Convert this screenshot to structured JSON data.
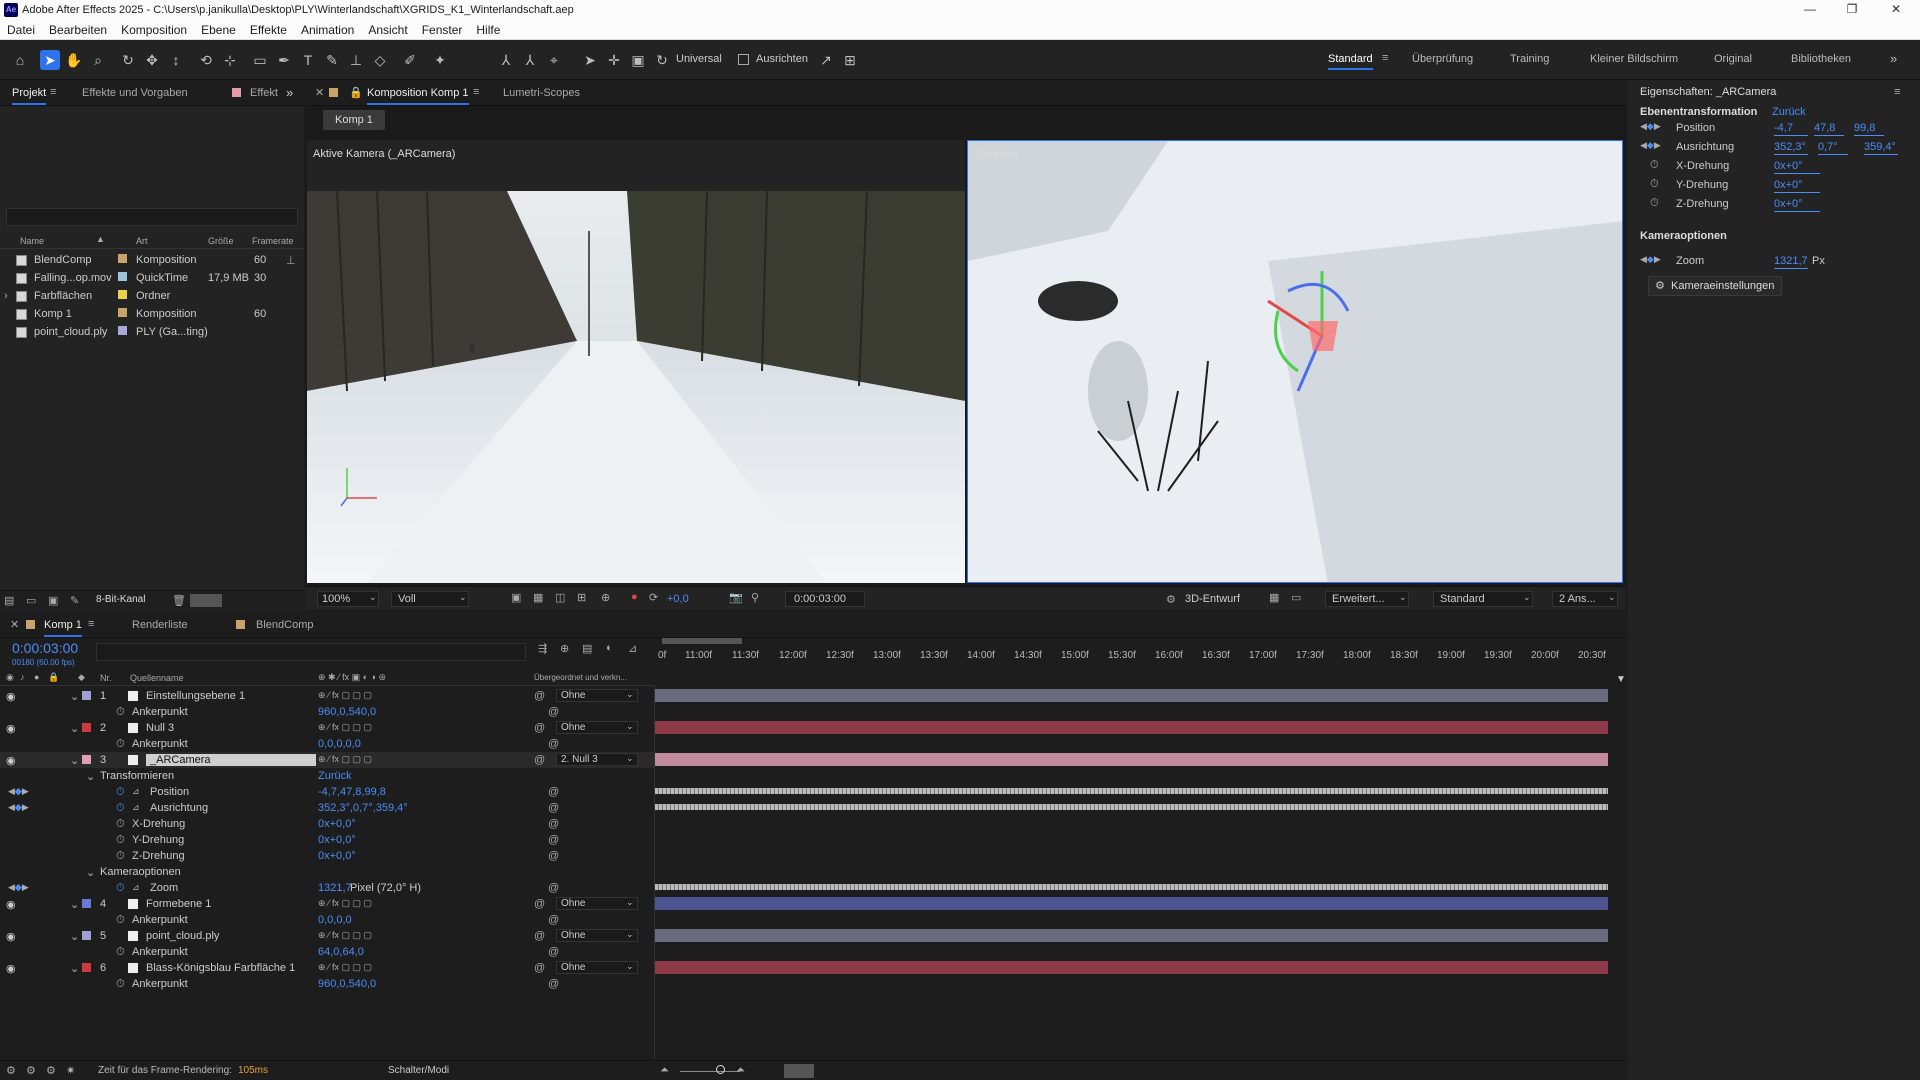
{
  "app": {
    "title": "Adobe After Effects 2025 - C:\\Users\\p.janikulla\\Desktop\\PLY\\Winterlandschaft\\XGRIDS_K1_Winterlandschaft.aep",
    "logo": "Ae"
  },
  "menu": [
    "Datei",
    "Bearbeiten",
    "Komposition",
    "Ebene",
    "Effekte",
    "Animation",
    "Ansicht",
    "Fenster",
    "Hilfe"
  ],
  "toolbar": {
    "universal": "Universal",
    "ausrichten": "Ausrichten"
  },
  "workspaces": [
    "Standard",
    "Überprüfung",
    "Training",
    "Kleiner Bildschirm",
    "Original",
    "Bibliotheken"
  ],
  "project": {
    "tabs": [
      "Projekt",
      "Effekte und Vorgaben",
      "Effekt"
    ],
    "columns": {
      "name": "Name",
      "type": "Art",
      "size": "Größe",
      "fps": "Framerate"
    },
    "items": [
      {
        "name": "BlendComp",
        "type": "Komposition",
        "size": "",
        "fps": "60",
        "color": "#c9a36a"
      },
      {
        "name": "Falling...op.mov",
        "type": "QuickTime",
        "size": "17,9 MB",
        "fps": "30",
        "color": "#9bc4e0"
      },
      {
        "name": "Farbflächen",
        "type": "Ordner",
        "size": "",
        "fps": "",
        "color": "#e8d24a"
      },
      {
        "name": "Komp 1",
        "type": "Komposition",
        "size": "",
        "fps": "60",
        "color": "#c9a36a"
      },
      {
        "name": "point_cloud.ply",
        "type": "PLY (Ga...ting)",
        "size": "",
        "fps": "",
        "color": "#a9a9d6"
      }
    ],
    "bitdepth": "8-Bit-Kanal"
  },
  "comp": {
    "tabs": [
      "Komposition Komp 1",
      "Lumetri-Scopes"
    ],
    "crumb": "Komp 1",
    "left_view_label": "Aktive Kamera (_ARCamera)",
    "right_view_label": "Standard",
    "bottom": {
      "zoom": "100%",
      "res": "Voll",
      "exposure": "+0,0",
      "time": "0:00:03:00",
      "renderer": "3D-Entwurf",
      "ext": "Erweitert...",
      "view": "Standard",
      "layout": "2 Ans..."
    }
  },
  "props": {
    "title": "Eigenschaften: _ARCamera",
    "section1": "Ebenentransformation",
    "reset": "Zurück",
    "rows": [
      {
        "label": "Position",
        "v1": "-4,7",
        "v2": "47,8",
        "v3": "99,8"
      },
      {
        "label": "Ausrichtung",
        "v1": "352,3°",
        "v2": "0,7°",
        "v3": "359,4°"
      },
      {
        "label": "X-Drehung",
        "v1": "0x+0°"
      },
      {
        "label": "Y-Drehung",
        "v1": "0x+0°"
      },
      {
        "label": "Z-Drehung",
        "v1": "0x+0°"
      }
    ],
    "section2": "Kameraoptionen",
    "zoom_label": "Zoom",
    "zoom_val": "1321,7",
    "zoom_unit": "Px",
    "settings_btn": "Kameraeinstellungen"
  },
  "timeline": {
    "tabs": [
      "Komp 1",
      "Renderliste",
      "BlendComp"
    ],
    "timecode": "0:00:03:00",
    "frames": "00180 (60.00 fps)",
    "hdr": {
      "nr": "Nr.",
      "src": "Quellenname",
      "parent": "Übergeordnet und verkn..."
    },
    "ruler": [
      "0f",
      "11:00f",
      "11:30f",
      "12:00f",
      "12:30f",
      "13:00f",
      "13:30f",
      "14:00f",
      "14:30f",
      "15:00f",
      "15:30f",
      "16:00f",
      "16:30f",
      "17:00f",
      "17:30f",
      "18:00f",
      "18:30f",
      "19:00f",
      "19:30f",
      "20:00f",
      "20:30f"
    ],
    "rows": [
      {
        "nr": "1",
        "name": "Einstellungsebene 1",
        "parent": "Ohne",
        "color": "#a0a0d6",
        "bar": "#6b6b80"
      },
      {
        "sub": "Ankerpunkt",
        "val": "960,0,540,0"
      },
      {
        "nr": "2",
        "name": "Null 3",
        "parent": "Ohne",
        "color": "#c83c3c",
        "bar": "#8c3a47"
      },
      {
        "sub": "Ankerpunkt",
        "val": "0,0,0,0,0"
      },
      {
        "nr": "3",
        "name": "_ARCamera",
        "parent": "2. Null 3",
        "color": "#e0a0b0",
        "bar": "#c28a9d"
      },
      {
        "group": "Transformieren",
        "val": "Zurück"
      },
      {
        "sub": "Position",
        "val": "-4,7,47,8,99,8"
      },
      {
        "sub": "Ausrichtung",
        "val": "352,3°,0,7°,359,4°"
      },
      {
        "sub": "X-Drehung",
        "val": "0x+0,0°"
      },
      {
        "sub": "Y-Drehung",
        "val": "0x+0,0°"
      },
      {
        "sub": "Z-Drehung",
        "val": "0x+0,0°"
      },
      {
        "group": "Kameraoptionen",
        "val": ""
      },
      {
        "sub": "Zoom",
        "val": "1321,7",
        "extra": "Pixel (72,0° H)"
      },
      {
        "nr": "4",
        "name": "Formebene 1",
        "parent": "Ohne",
        "color": "#6a78d8",
        "bar": "#4c5590"
      },
      {
        "sub": "Ankerpunkt",
        "val": "0,0,0,0"
      },
      {
        "nr": "5",
        "name": "point_cloud.ply",
        "parent": "Ohne",
        "color": "#a0a0d6",
        "bar": "#6b6b80"
      },
      {
        "sub": "Ankerpunkt",
        "val": "64,0,64,0"
      },
      {
        "nr": "6",
        "name": "Blass-Königsblau Farbfläche 1",
        "parent": "Ohne",
        "color": "#c83c3c",
        "bar": "#8c3a47"
      },
      {
        "sub": "Ankerpunkt",
        "val": "960,0,540,0"
      }
    ],
    "status": {
      "render_label": "Zeit für das Frame-Rendering:",
      "render_val": "105ms",
      "mode": "Schalter/Modi"
    }
  }
}
